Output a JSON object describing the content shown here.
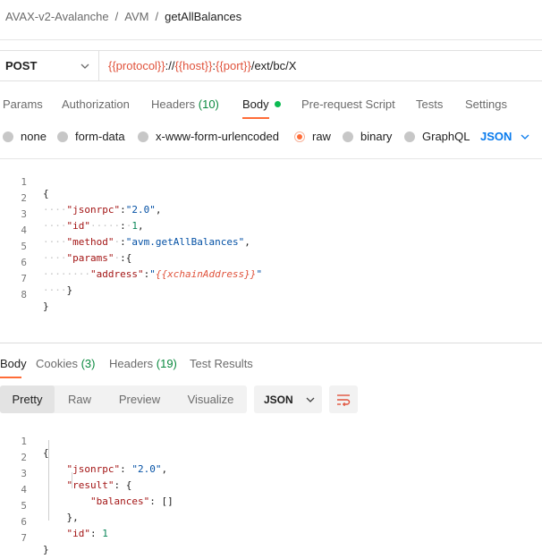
{
  "breadcrumb": {
    "items": [
      "AVAX-v2-Avalanche",
      "AVM"
    ],
    "separator": "/",
    "current": "getAllBalances"
  },
  "request": {
    "method": "POST",
    "url_parts": [
      {
        "text": "{{protocol}}",
        "type": "var"
      },
      {
        "text": "://",
        "type": "plain"
      },
      {
        "text": "{{host}}",
        "type": "var"
      },
      {
        "text": ":",
        "type": "plain"
      },
      {
        "text": "{{port}}",
        "type": "var"
      },
      {
        "text": "/ext/bc/X",
        "type": "plain"
      }
    ]
  },
  "request_tabs": {
    "params": "Params",
    "authorization": "Authorization",
    "headers": "Headers",
    "headers_count": "(10)",
    "body": "Body",
    "prerequest": "Pre-request Script",
    "tests": "Tests",
    "settings": "Settings"
  },
  "body_types": {
    "none": "none",
    "form_data": "form-data",
    "urlencoded": "x-www-form-urlencoded",
    "raw": "raw",
    "binary": "binary",
    "graphql": "GraphQL",
    "selected": "raw",
    "language": "JSON"
  },
  "request_body_lines": [
    "1",
    "2",
    "3",
    "4",
    "5",
    "6",
    "7",
    "8"
  ],
  "request_body": {
    "key_jsonrpc": "\"jsonrpc\"",
    "val_jsonrpc": "\"2.0\"",
    "key_id": "\"id\"",
    "val_id": "1",
    "key_method": "\"method\"",
    "val_method": "\"avm.getAllBalances\"",
    "key_params": "\"params\"",
    "key_address": "\"address\"",
    "val_address_var": "{{xchainAddress}}"
  },
  "response_tabs": {
    "body": "Body",
    "cookies": "Cookies",
    "cookies_count": "(3)",
    "headers": "Headers",
    "headers_count": "(19)",
    "test_results": "Test Results"
  },
  "response_view": {
    "pretty": "Pretty",
    "raw": "Raw",
    "preview": "Preview",
    "visualize": "Visualize",
    "format": "JSON",
    "active": "Pretty"
  },
  "response_body_lines": [
    "1",
    "2",
    "3",
    "4",
    "5",
    "6",
    "7"
  ],
  "response_body": {
    "key_jsonrpc": "\"jsonrpc\"",
    "val_jsonrpc": "\"2.0\"",
    "key_result": "\"result\"",
    "key_balances": "\"balances\"",
    "val_balances": "[]",
    "key_id": "\"id\"",
    "val_id": "1"
  },
  "colors": {
    "accent": "#ff6c37",
    "variable": "#e0533c",
    "link_blue": "#097bed",
    "count_green": "#0b8a3f"
  }
}
